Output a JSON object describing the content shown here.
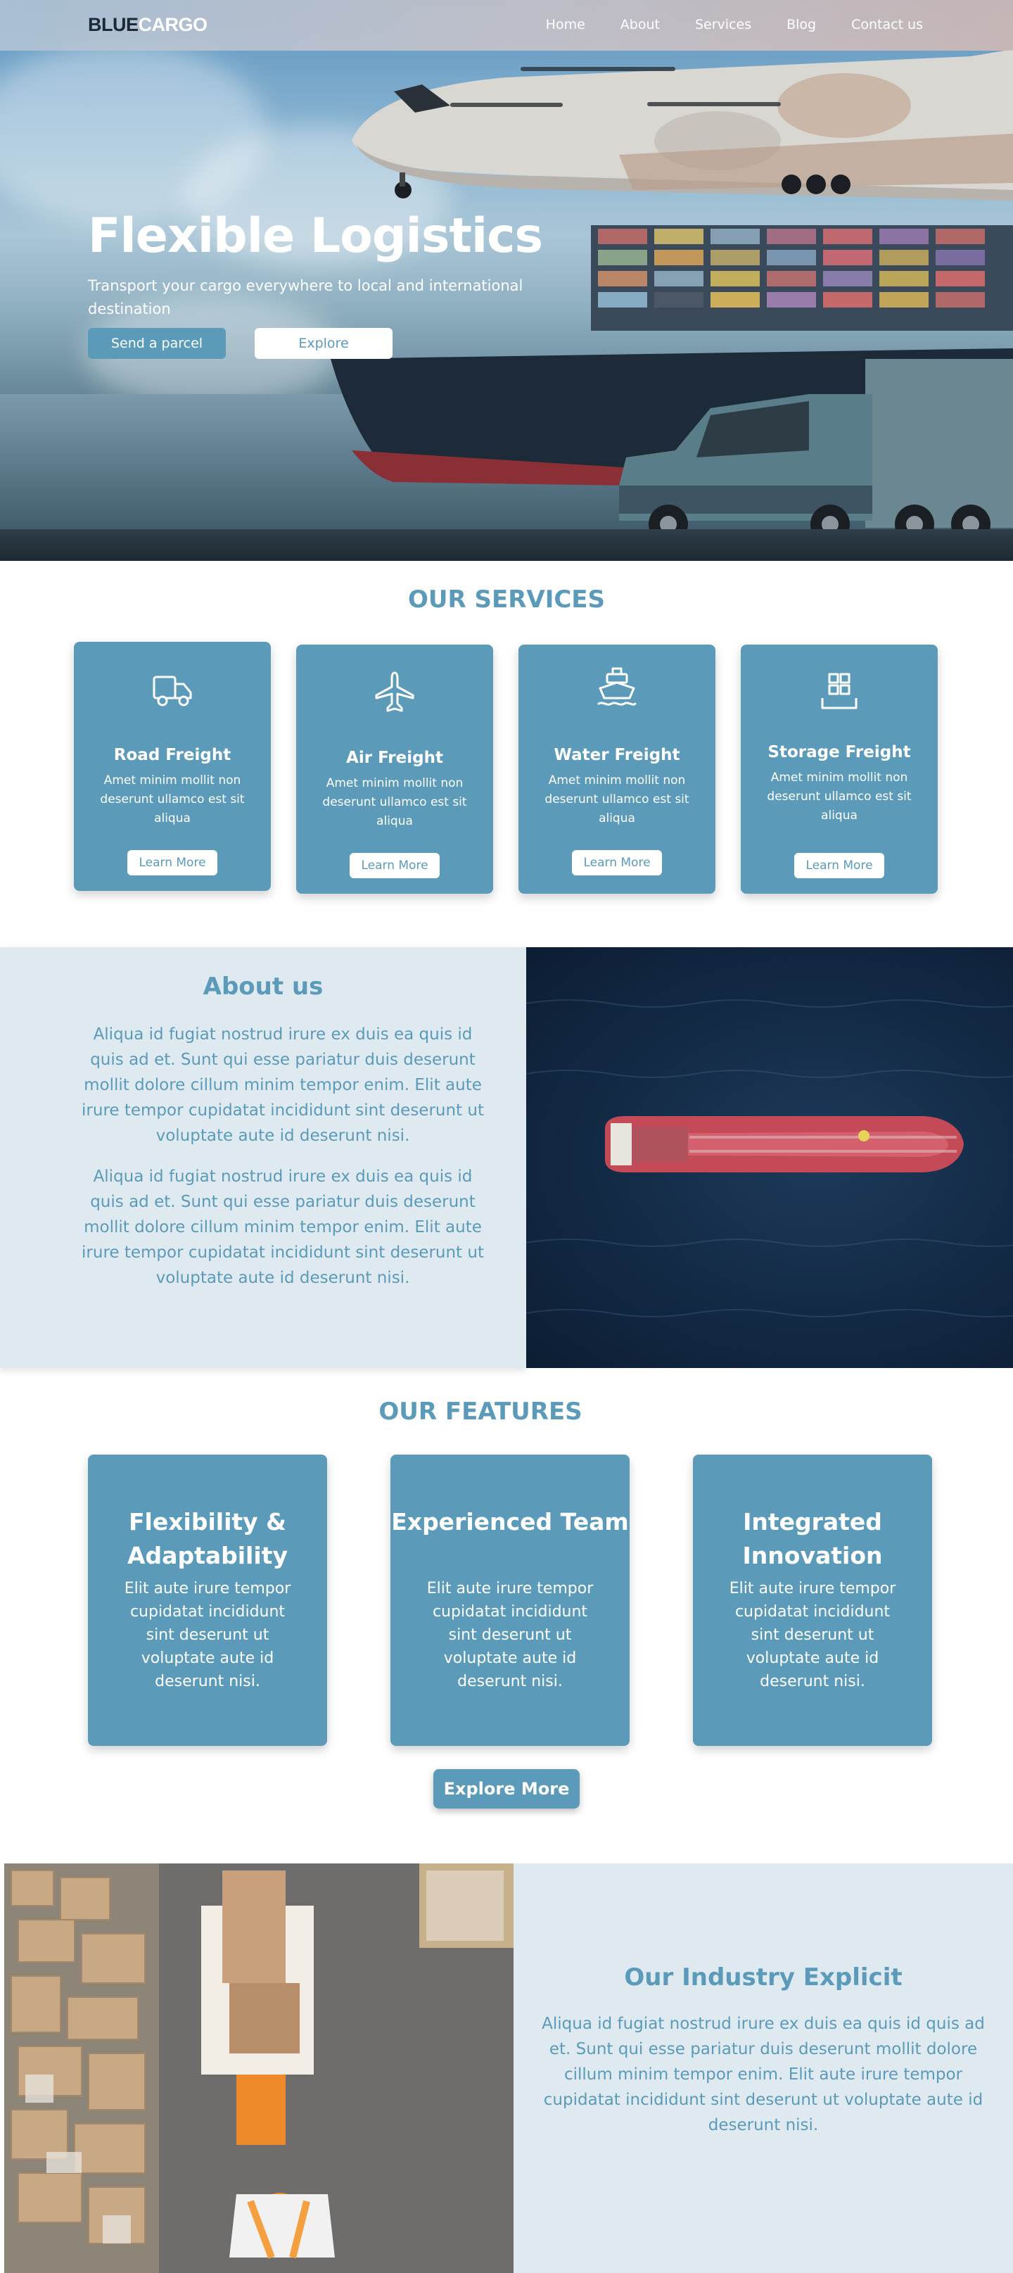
{
  "brand": {
    "part1": "BLUE",
    "part2": "CARGO"
  },
  "nav": {
    "items": [
      "Home",
      "About",
      "Services",
      "Blog",
      "Contact us"
    ]
  },
  "hero": {
    "title": "Flexible Logistics",
    "subtitle": "Transport your cargo everywhere to local and international destination",
    "primary_button": "Send a parcel",
    "secondary_button": "Explore"
  },
  "services": {
    "title": "OUR SERVICES",
    "items": [
      {
        "icon": "truck-icon",
        "title": "Road Freight",
        "text": "Amet minim mollit non deserunt ullamco est sit aliqua",
        "button": "Learn More"
      },
      {
        "icon": "airplane-icon",
        "title": "Air Freight",
        "text": "Amet minim mollit non deserunt ullamco est sit aliqua",
        "button": "Learn More"
      },
      {
        "icon": "ship-icon",
        "title": "Water Freight",
        "text": "Amet minim mollit non deserunt ullamco est sit aliqua",
        "button": "Learn More"
      },
      {
        "icon": "storage-boxes-icon",
        "title": "Storage Freight",
        "text": "Amet minim mollit non deserunt ullamco est sit aliqua",
        "button": "Learn More"
      }
    ]
  },
  "about": {
    "title": "About us",
    "paragraphs": [
      "Aliqua id fugiat nostrud irure ex duis ea quis id quis ad et. Sunt qui esse pariatur duis deserunt mollit dolore cillum minim tempor enim. Elit aute irure tempor cupidatat incididunt sint deserunt ut voluptate aute id deserunt nisi.",
      "Aliqua id fugiat nostrud irure ex duis ea quis id quis ad et. Sunt qui esse pariatur duis deserunt mollit dolore cillum minim tempor enim. Elit aute irure tempor cupidatat incididunt sint deserunt ut voluptate aute id deserunt nisi."
    ]
  },
  "features": {
    "title": "OUR FEATURES",
    "items": [
      {
        "title": "Flexibility & Adaptability",
        "text": "Elit aute irure tempor cupidatat incididunt sint deserunt ut voluptate aute id deserunt nisi."
      },
      {
        "title": "Experienced Team",
        "text": "Elit aute irure tempor cupidatat incididunt sint deserunt ut voluptate aute id deserunt nisi."
      },
      {
        "title": "Integrated Innovation",
        "text": "Elit aute irure tempor cupidatat incididunt sint deserunt ut voluptate aute id deserunt nisi."
      }
    ],
    "button": "Explore More"
  },
  "industry": {
    "title": "Our Industry Explicit",
    "text": "Aliqua id fugiat nostrud irure ex duis ea quis id quis ad et. Sunt qui esse pariatur duis deserunt mollit dolore cillum minim tempor enim. Elit aute irure tempor cupidatat incididunt sint deserunt ut voluptate aute id deserunt nisi."
  },
  "colors": {
    "accent": "#5b9bb9",
    "panel": "#dfe9f0",
    "dark": "#1d2a36"
  }
}
